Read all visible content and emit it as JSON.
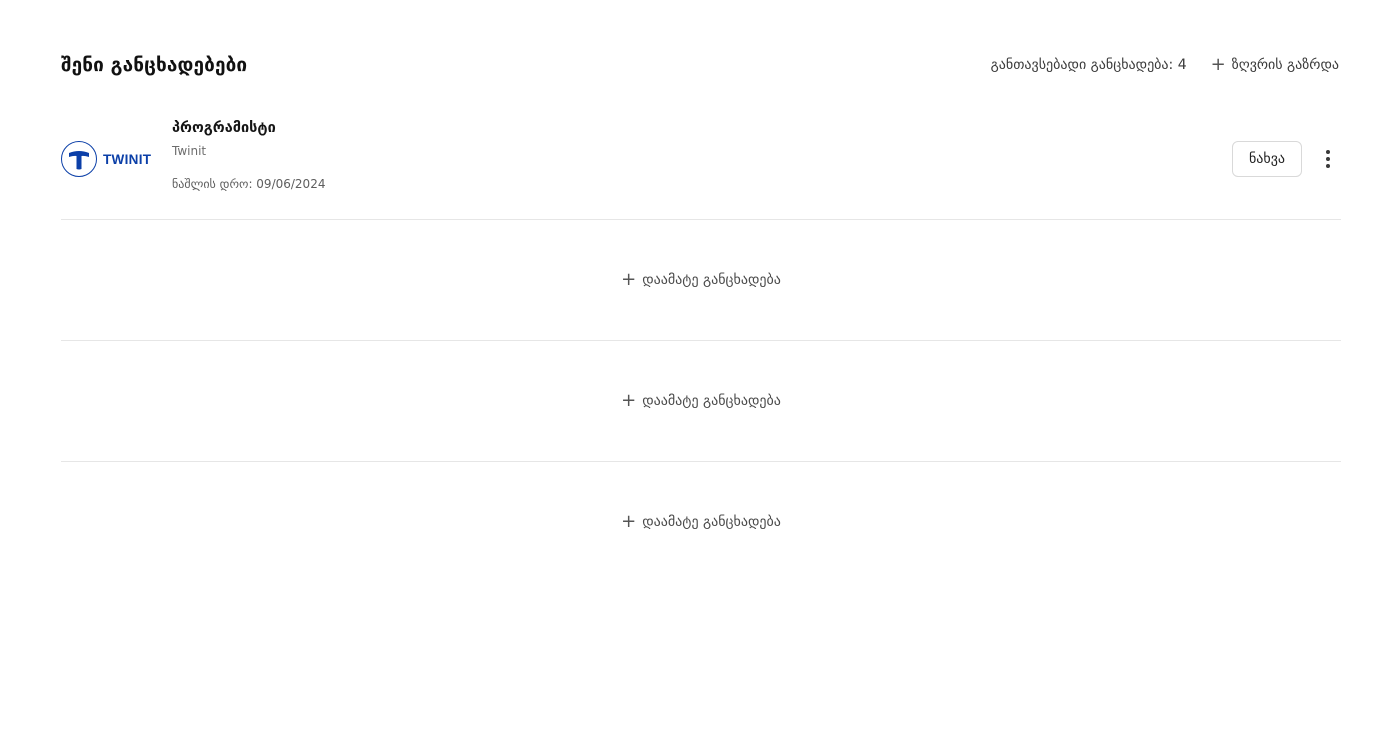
{
  "header": {
    "title": "შენი განცხადებები",
    "limit_label": "განთავსებადი განცხადება: 4",
    "increase_limit_label": "ზღვრის გაზრდა"
  },
  "applications": [
    {
      "title": "პროგრამისტი",
      "company": "Twinit",
      "logo_text": "TWINIT",
      "deadline": "ნაშლის დრო: 09/06/2024",
      "view_label": "ნახვა"
    }
  ],
  "empty_slots": [
    {
      "label": "დაამატე განცხადება"
    },
    {
      "label": "დაამატე განცხადება"
    },
    {
      "label": "დაამატე განცხადება"
    }
  ],
  "colors": {
    "brand": "#0b3fa8",
    "divider": "#e6e6e6"
  },
  "icons": {
    "add": "plus-icon",
    "more": "more-vertical-icon"
  }
}
